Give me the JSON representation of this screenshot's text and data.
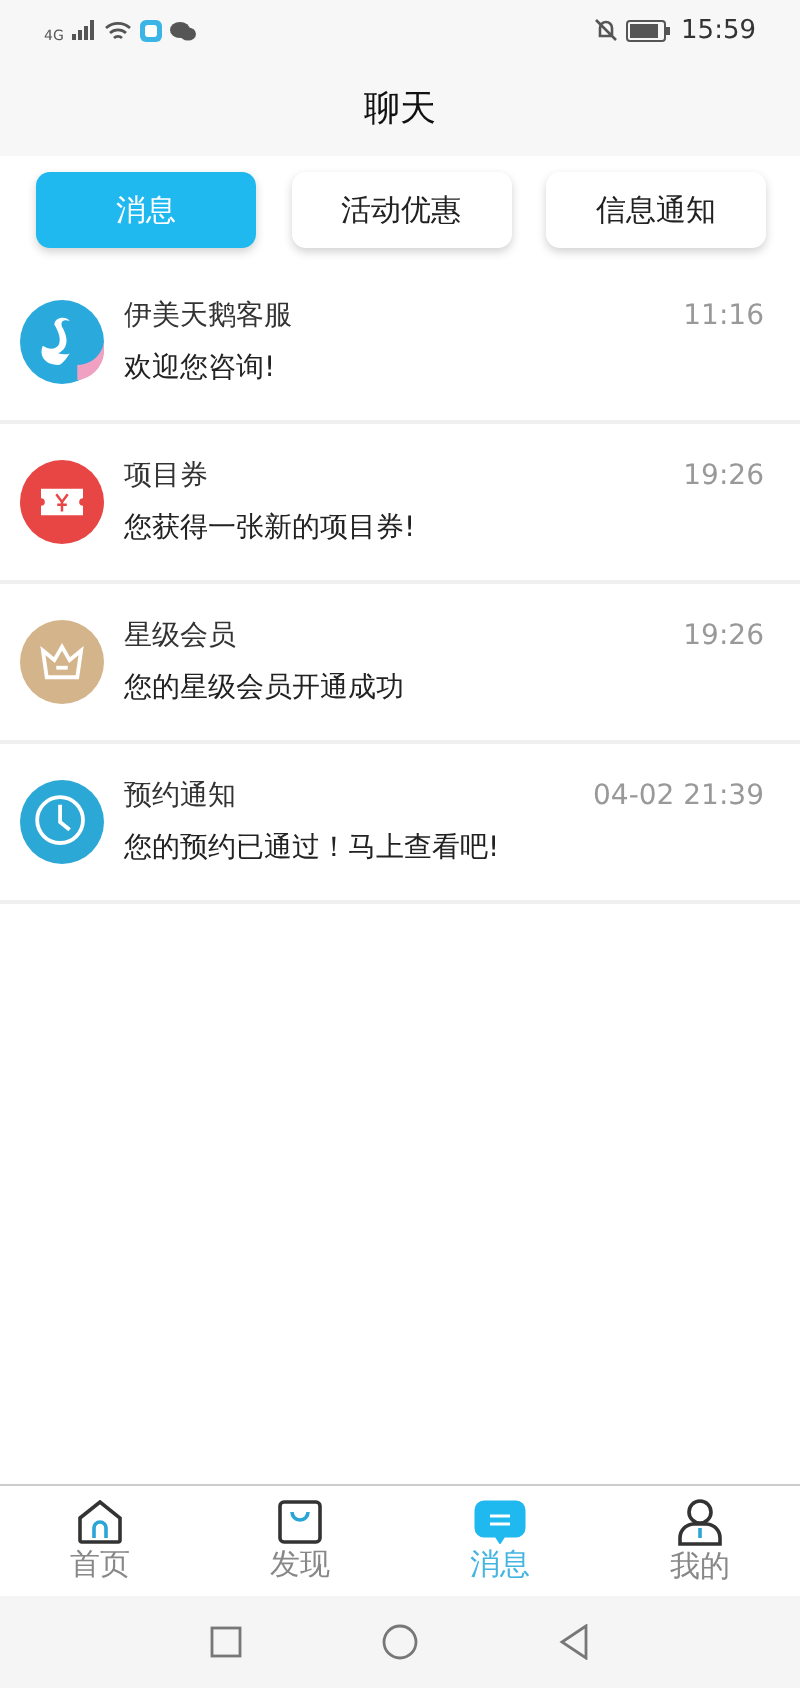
{
  "status_bar": {
    "network": "4G",
    "time": "15:59"
  },
  "header": {
    "title": "聊天"
  },
  "tabs": [
    {
      "label": "消息",
      "selected": true
    },
    {
      "label": "活动优惠",
      "selected": false
    },
    {
      "label": "信息通知",
      "selected": false
    }
  ],
  "messages": [
    {
      "kind": "swan",
      "name": "伊美天鹅客服",
      "time": "11:16",
      "preview": "欢迎您咨询!"
    },
    {
      "kind": "ticket",
      "name": "项目券",
      "time": "19:26",
      "preview": "您获得一张新的项目券!"
    },
    {
      "kind": "crown",
      "name": "星级会员",
      "time": "19:26",
      "preview": "您的星级会员开通成功"
    },
    {
      "kind": "clock",
      "name": "预约通知",
      "time": "04-02 21:39",
      "preview": "您的预约已通过！马上查看吧!"
    }
  ],
  "bottom_nav": [
    {
      "kind": "home",
      "label": "首页",
      "selected": false
    },
    {
      "kind": "bag",
      "label": "发现",
      "selected": false
    },
    {
      "kind": "chat",
      "label": "消息",
      "selected": true
    },
    {
      "kind": "person",
      "label": "我的",
      "selected": false
    }
  ]
}
